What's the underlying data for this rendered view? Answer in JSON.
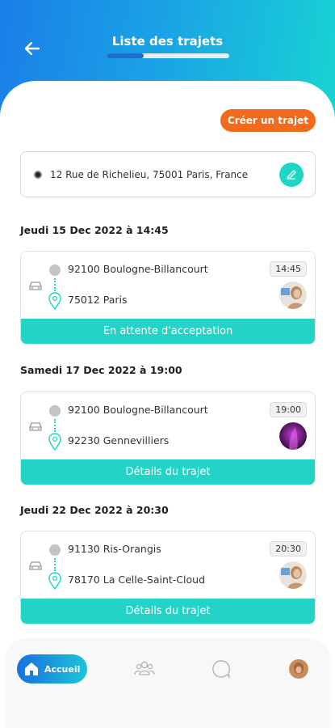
{
  "header": {
    "title": "Liste des trajets",
    "progress": 0.3
  },
  "actions": {
    "create_label": "Créer un trajet"
  },
  "address": {
    "text": "12 Rue de Richelieu, 75001 Paris, France"
  },
  "trips": [
    {
      "date_heading": "Jeudi 15 Dec 2022 à 14:45",
      "from": "92100 Boulogne-Billancourt",
      "to": "75012 Paris",
      "time": "14:45",
      "action": "En attente d'acceptation"
    },
    {
      "date_heading": "Samedi 17 Dec 2022 à 19:00",
      "from": "92100 Boulogne-Billancourt",
      "to": "92230 Gennevilliers",
      "time": "19:00",
      "action": "Détails du trajet"
    },
    {
      "date_heading": "Jeudi 22 Dec 2022 à 20:30",
      "from": "91130 Ris-Orangis",
      "to": "78170 La Celle-Saint-Cloud",
      "time": "20:30",
      "action": "Détails du trajet"
    }
  ],
  "nav": {
    "home_label": "Accueil",
    "icons": [
      "home-icon",
      "group-icon",
      "chat-icon",
      "profile-avatar"
    ]
  },
  "colors": {
    "accent": "#22d3c6",
    "orange": "#f26a1b",
    "header_start": "#1a7ee8",
    "header_end": "#17d6d2"
  }
}
